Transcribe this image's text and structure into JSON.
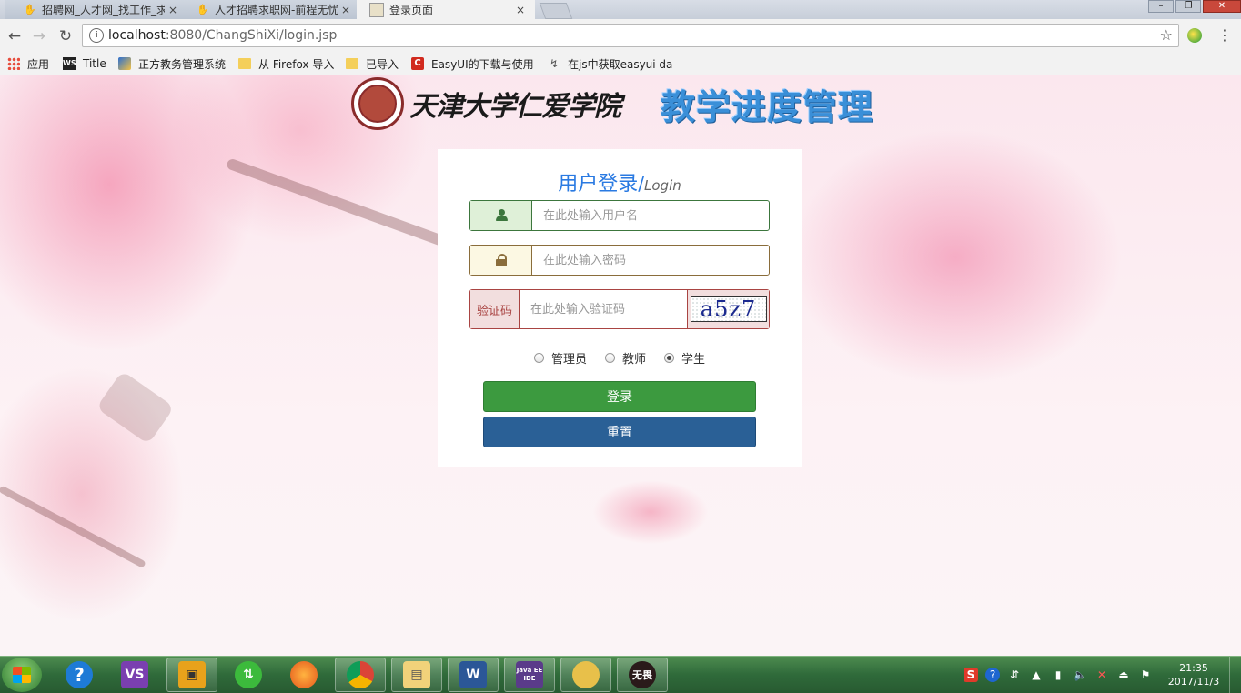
{
  "browser": {
    "tabs": [
      {
        "title": "招聘网_人才网_找工作_求",
        "close": "×"
      },
      {
        "title": "人才招聘求职网-前程无忧",
        "close": "×"
      },
      {
        "title": "登录页面",
        "close": "×"
      }
    ],
    "url_host": "localhost",
    "url_path": ":8080/ChangShiXi/login.jsp",
    "bookmarks": [
      {
        "label": "应用",
        "icon": "apps-grid-icon"
      },
      {
        "label": "Title",
        "icon": "ws-icon"
      },
      {
        "label": "正方教务管理系统",
        "icon": "zf-icon"
      },
      {
        "label": "从 Firefox 导入",
        "icon": "folder-icon"
      },
      {
        "label": "已导入",
        "icon": "folder-icon"
      },
      {
        "label": "EasyUI的下载与使用",
        "icon": "easyui-icon"
      },
      {
        "label": "在js中获取easyui da",
        "icon": "link-icon"
      }
    ]
  },
  "header": {
    "university": "天津大学仁爱学院",
    "system_title": "教学进度管理"
  },
  "login": {
    "title_cn": "用户登录",
    "title_slash": "/",
    "title_en": "Login",
    "username_placeholder": "在此处输入用户名",
    "password_placeholder": "在此处输入密码",
    "captcha_label": "验证码",
    "captcha_placeholder": "在此处输入验证码",
    "captcha_text": "a5z7",
    "roles": [
      {
        "label": "管理员",
        "checked": false
      },
      {
        "label": "教师",
        "checked": false
      },
      {
        "label": "学生",
        "checked": true
      }
    ],
    "login_button": "登录",
    "reset_button": "重置"
  },
  "taskbar": {
    "time": "21:35",
    "date": "2017/11/3",
    "apps": [
      "help",
      "visual-studio",
      "document-viewer",
      "sync",
      "firefox",
      "chrome",
      "file-explorer",
      "word",
      "java-ee-ide",
      "media",
      "wuwei"
    ],
    "app_labels": {
      "word": "W",
      "java": "Java EE IDE",
      "wuwei": "无畏"
    }
  },
  "colors": {
    "title_blue": "#2a7ae2",
    "success_green": "#3c9a3f",
    "primary_blue": "#2a6096",
    "captcha_red": "#a94442"
  }
}
